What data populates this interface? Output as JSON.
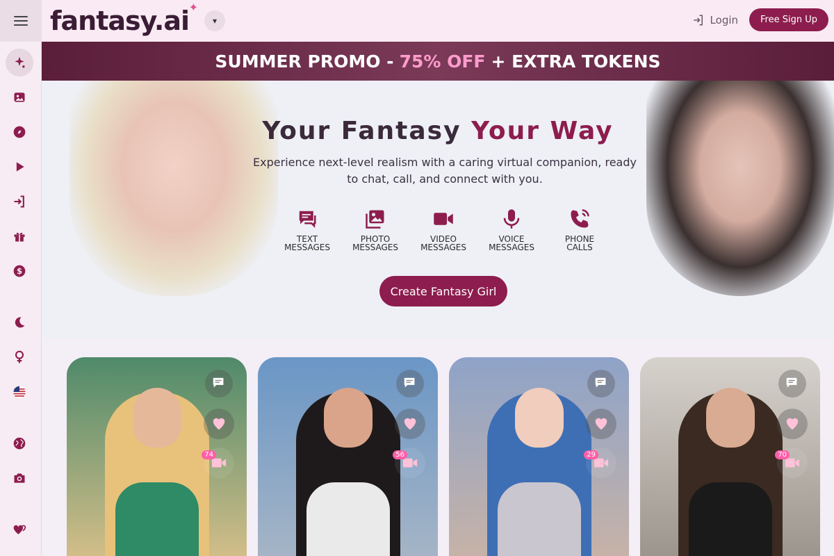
{
  "header": {
    "logo_text": "fantasy.ai",
    "login_label": "Login",
    "signup_label": "Free Sign Up"
  },
  "sidebar": {
    "items": [
      {
        "name": "generate",
        "icon": "sparkle-icon",
        "active": true
      },
      {
        "name": "gallery",
        "icon": "image-icon"
      },
      {
        "name": "explore",
        "icon": "compass-icon"
      },
      {
        "name": "videos",
        "icon": "play-icon"
      },
      {
        "name": "login",
        "icon": "login-icon"
      },
      {
        "name": "gifts",
        "icon": "gift-icon"
      },
      {
        "name": "pricing",
        "icon": "dollar-icon"
      },
      {
        "name": "theme",
        "icon": "moon-icon"
      },
      {
        "name": "gender",
        "icon": "female-icon"
      },
      {
        "name": "language",
        "icon": "us-flag-icon"
      },
      {
        "name": "region",
        "icon": "globe-icon"
      },
      {
        "name": "camera",
        "icon": "camera-icon"
      },
      {
        "name": "favorites",
        "icon": "hearts-icon"
      }
    ]
  },
  "promo": {
    "part1": "SUMMER PROMO -",
    "highlight": "75% OFF",
    "part2": "+ EXTRA TOKENS"
  },
  "hero": {
    "title_part1": "Your Fantasy",
    "title_part2": "Your Way",
    "subtitle": "Experience next-level realism with a caring virtual companion, ready to chat, call, and connect with you.",
    "features": [
      {
        "line1": "TEXT",
        "line2": "MESSAGES",
        "icon": "chat-icon"
      },
      {
        "line1": "PHOTO",
        "line2": "MESSAGES",
        "icon": "photo-icon"
      },
      {
        "line1": "VIDEO",
        "line2": "MESSAGES",
        "icon": "video-icon"
      },
      {
        "line1": "VOICE",
        "line2": "MESSAGES",
        "icon": "mic-icon"
      },
      {
        "line1": "PHONE",
        "line2": "CALLS",
        "icon": "phone-icon"
      }
    ],
    "cta_label": "Create Fantasy Girl"
  },
  "cards": [
    {
      "video_count": "74",
      "colors": {
        "bg_top": "#4f8a6a",
        "bg_bottom": "#d8c08a",
        "hair": "#e8c27a",
        "skin": "#e6b89a",
        "outfit": "#2f8a66"
      }
    },
    {
      "video_count": "56",
      "colors": {
        "bg_top": "#6a96c6",
        "bg_bottom": "#a8b6c6",
        "hair": "#1e1a1c",
        "skin": "#d9a48a",
        "outfit": "#eaeaea"
      }
    },
    {
      "video_count": "29",
      "colors": {
        "bg_top": "#8ea3c8",
        "bg_bottom": "#c9b3a6",
        "hair": "#3e6fb5",
        "skin": "#f0cdbd",
        "outfit": "#c9c6cf"
      }
    },
    {
      "video_count": "70",
      "colors": {
        "bg_top": "#d6d2cc",
        "bg_bottom": "#9a928a",
        "hair": "#3a2a22",
        "skin": "#d9ab92",
        "outfit": "#1a1a1a"
      }
    }
  ]
}
